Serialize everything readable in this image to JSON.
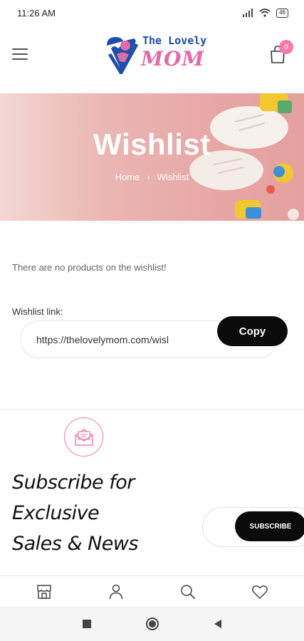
{
  "status_bar": {
    "time": "11:26 AM",
    "battery": "46"
  },
  "header": {
    "logo_line1": "The Lovely",
    "logo_line2": "MOM",
    "cart_count": "0"
  },
  "hero": {
    "title": "Wishlist",
    "breadcrumb": {
      "home": "Home",
      "separator": "›",
      "current": "Wishlist"
    }
  },
  "wishlist": {
    "empty_message": "There are no products on the wishlist!",
    "link_label": "Wishlist link:",
    "link_value": "https://thelovelymom.com/wisl",
    "copy_label": "Copy"
  },
  "subscribe": {
    "line1": "Subscribe for",
    "line2": "Exclusive",
    "line3": "Sales & News",
    "button_label": "SUBSCRIBE"
  },
  "bottom_nav": {
    "items": [
      "shop-icon",
      "user-icon",
      "search-icon",
      "heart-icon"
    ]
  },
  "colors": {
    "accent_pink": "#f47bab",
    "brand_blue": "#1f4fa8",
    "button_black": "#0b0b0b"
  }
}
